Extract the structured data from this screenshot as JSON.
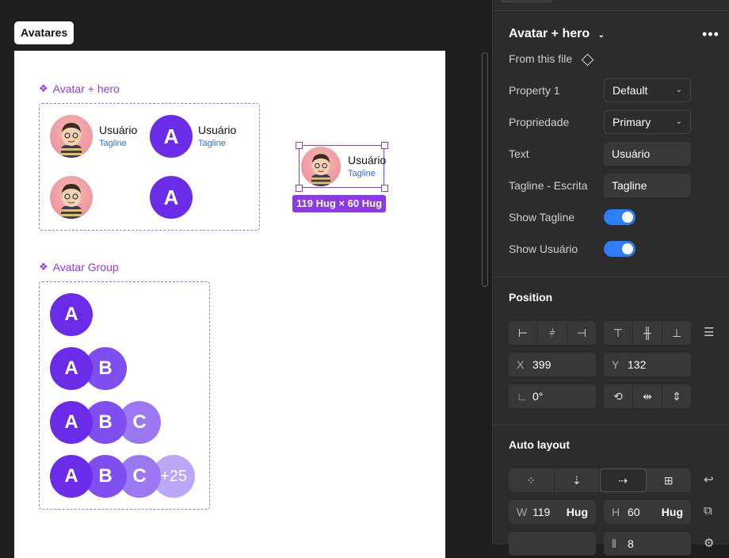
{
  "canvas": {
    "frame_label": "Avatares",
    "section1_title": "Avatar + hero",
    "section2_title": "Avatar Group",
    "component_icon": "component-diamonds-icon",
    "avatars": [
      {
        "name": "Usuário",
        "tagline": "Tagline",
        "type": "photo"
      },
      {
        "name": "Usuário",
        "tagline": "Tagline",
        "type": "letter",
        "letter": "A"
      },
      {
        "type": "photo"
      },
      {
        "type": "letter",
        "letter": "A"
      }
    ],
    "selected": {
      "name": "Usuário",
      "tagline": "Tagline",
      "size_label": "119 Hug × 60 Hug"
    },
    "group_rows": [
      [
        "A"
      ],
      [
        "A",
        "B"
      ],
      [
        "A",
        "B",
        "C"
      ],
      [
        "A",
        "B",
        "C",
        "+25"
      ]
    ],
    "colors": {
      "accent": "#8b3ae6",
      "avatar_dark": "#6a2ce8",
      "avatar_b": "#7f4ef0",
      "avatar_c": "#9b78f2",
      "avatar_more": "#bca6f7",
      "tagline": "#2a6fd6"
    }
  },
  "panel": {
    "title": "Avatar + hero",
    "from_file": "From this file",
    "properties": [
      {
        "label": "Property 1",
        "value": "Default",
        "kind": "select"
      },
      {
        "label": "Propriedade",
        "value": "Primary",
        "kind": "select"
      },
      {
        "label": "Text",
        "value": "Usuário",
        "kind": "input"
      },
      {
        "label": "Tagline - Escrita",
        "value": "Tagline",
        "kind": "input"
      },
      {
        "label": "Show Tagline",
        "value": "on",
        "kind": "toggle"
      },
      {
        "label": "Show Usuário",
        "value": "on",
        "kind": "toggle"
      }
    ],
    "position": {
      "title": "Position",
      "x_label": "X",
      "x_value": "399",
      "y_label": "Y",
      "y_value": "132",
      "rotation": "0°"
    },
    "auto_layout": {
      "title": "Auto layout",
      "w_label": "W",
      "w_value": "119",
      "w_mode": "Hug",
      "h_label": "H",
      "h_value": "60",
      "h_mode": "Hug",
      "gap_value": "8"
    }
  }
}
